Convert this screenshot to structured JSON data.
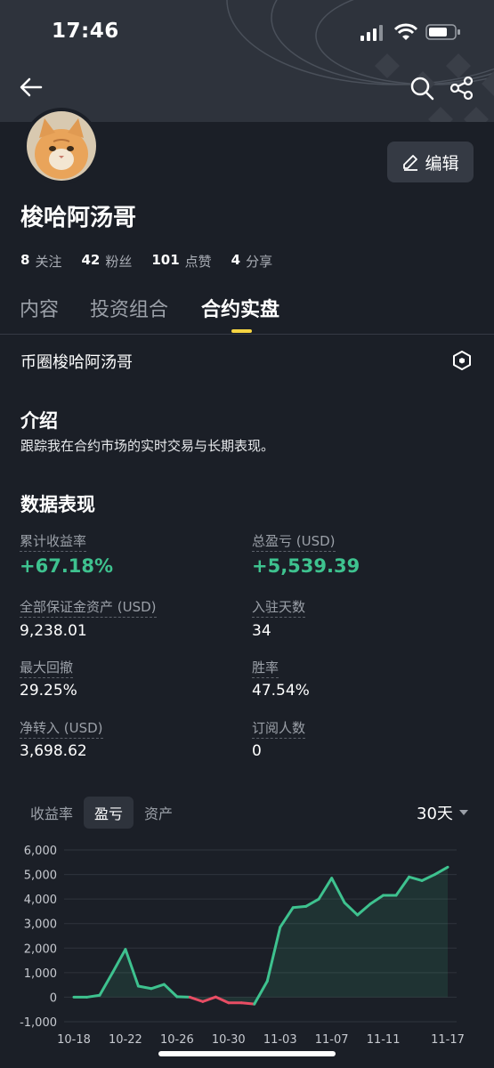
{
  "status_bar": {
    "time": "17:46"
  },
  "profile": {
    "edit_label": "编辑",
    "username": "梭哈阿汤哥",
    "stats": [
      {
        "value": "8",
        "label": "关注"
      },
      {
        "value": "42",
        "label": "粉丝"
      },
      {
        "value": "101",
        "label": "点赞"
      },
      {
        "value": "4",
        "label": "分享"
      }
    ]
  },
  "tabs": [
    "内容",
    "投资组合",
    "合约实盘"
  ],
  "active_tab": "合约实盘",
  "circle_name": "币圈梭哈阿汤哥",
  "intro": {
    "title": "介绍",
    "text": "跟踪我在合约市场的实时交易与长期表现。"
  },
  "performance": {
    "title": "数据表现",
    "metrics": [
      {
        "label": "累计收益率",
        "value": "+67.18%"
      },
      {
        "label": "总盈亏 (USD)",
        "value": "+5,539.39"
      },
      {
        "label": "全部保证金资产 (USD)",
        "value": "9,238.01"
      },
      {
        "label": "入驻天数",
        "value": "34"
      },
      {
        "label": "最大回撤",
        "value": "29.25%"
      },
      {
        "label": "胜率",
        "value": "47.54%"
      },
      {
        "label": "净转入 (USD)",
        "value": "3,698.62"
      },
      {
        "label": "订阅人数",
        "value": "0"
      }
    ]
  },
  "chart_tabs": [
    "收益率",
    "盈亏",
    "资产"
  ],
  "active_chart_tab": "盈亏",
  "range": "30天",
  "colors": {
    "positive": "#3ec28f",
    "negative": "#e84d64",
    "accent": "#f5d442"
  },
  "chart_data": {
    "type": "line",
    "title": "",
    "xlabel": "",
    "ylabel": "",
    "ylim": [
      -1000,
      6000
    ],
    "yticks": [
      -1000,
      0,
      1000,
      2000,
      3000,
      4000,
      5000,
      6000
    ],
    "ytick_labels": [
      "-1,000",
      "0",
      "1,000",
      "2,000",
      "3,000",
      "4,000",
      "5,000",
      "6,000"
    ],
    "xtick_labels": [
      "10-18",
      "10-22",
      "10-26",
      "10-30",
      "11-03",
      "11-07",
      "11-11",
      "11-17"
    ],
    "xtick_index": [
      0,
      4,
      8,
      12,
      16,
      20,
      24,
      29
    ],
    "x": [
      "10-18",
      "10-19",
      "10-20",
      "10-21",
      "10-22",
      "10-23",
      "10-24",
      "10-25",
      "10-26",
      "10-27",
      "10-28",
      "10-29",
      "10-30",
      "10-31",
      "11-01",
      "11-02",
      "11-03",
      "11-04",
      "11-05",
      "11-06",
      "11-07",
      "11-08",
      "11-09",
      "11-10",
      "11-11",
      "11-12",
      "11-13",
      "11-14",
      "11-15",
      "11-17"
    ],
    "values": [
      0,
      0,
      80,
      1000,
      1950,
      450,
      350,
      520,
      20,
      0,
      -180,
      10,
      -230,
      -230,
      -280,
      650,
      2850,
      3650,
      3700,
      4000,
      4850,
      3850,
      3350,
      3800,
      4150,
      4150,
      4900,
      4750,
      5000,
      5300
    ]
  }
}
